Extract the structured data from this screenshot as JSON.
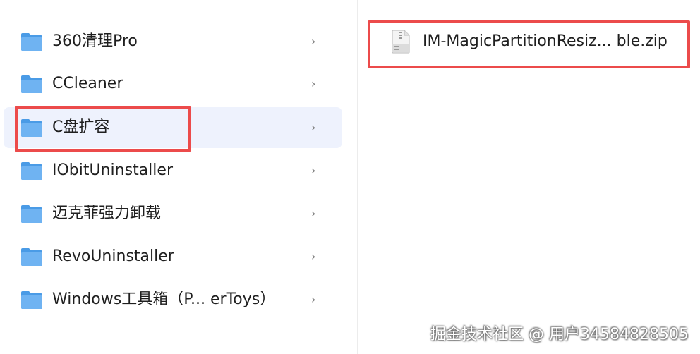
{
  "folders": [
    {
      "label": "360清理Pro",
      "chevron": "›",
      "selected": false
    },
    {
      "label": "CCleaner",
      "chevron": "›",
      "selected": false
    },
    {
      "label": "C盘扩容",
      "chevron": "›",
      "selected": true
    },
    {
      "label": "IObitUninstaller",
      "chevron": "›",
      "selected": false
    },
    {
      "label": "迈克菲强力卸载",
      "chevron": "›",
      "selected": false
    },
    {
      "label": "RevoUninstaller",
      "chevron": "›",
      "selected": false
    },
    {
      "label": "Windows工具箱（P... erToys）",
      "chevron": "›",
      "selected": false
    }
  ],
  "files": [
    {
      "label": "IM-MagicPartitionResiz... ble.zip",
      "icon": "zip-archive-icon"
    }
  ],
  "watermark": "掘金技术社区 @ 用户34584828505",
  "colors": {
    "folder": "#6fb3f2",
    "folder_dark": "#4a9be6",
    "selection_bg": "#eef2fd",
    "highlight_box": "#ec4b4b"
  }
}
